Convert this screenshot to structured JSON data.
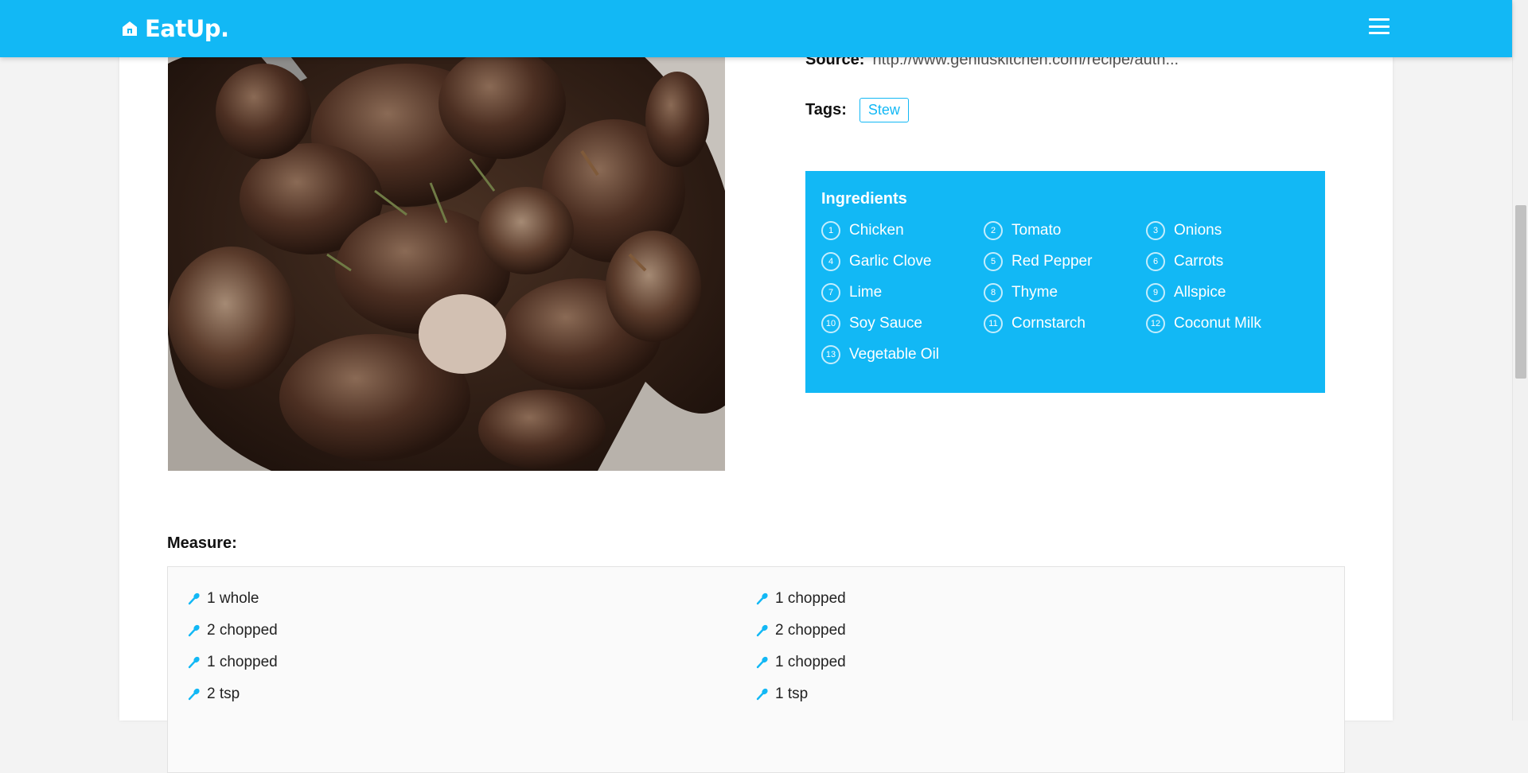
{
  "header": {
    "brand": "EatUp.",
    "brand_icon": "home-icon",
    "menu_icon": "hamburger-icon"
  },
  "colors": {
    "accent": "#12b8f5"
  },
  "recipe": {
    "source_label": "Source:",
    "source_url": "http://www.geniuskitchen.com/recipe/auth...",
    "tags_label": "Tags:",
    "tags": [
      "Stew"
    ]
  },
  "ingredients": {
    "title": "Ingredients",
    "items": [
      {
        "num": "1",
        "name": "Chicken"
      },
      {
        "num": "2",
        "name": "Tomato"
      },
      {
        "num": "3",
        "name": "Onions"
      },
      {
        "num": "4",
        "name": "Garlic Clove"
      },
      {
        "num": "5",
        "name": "Red Pepper"
      },
      {
        "num": "6",
        "name": "Carrots"
      },
      {
        "num": "7",
        "name": "Lime"
      },
      {
        "num": "8",
        "name": "Thyme"
      },
      {
        "num": "9",
        "name": "Allspice"
      },
      {
        "num": "10",
        "name": "Soy Sauce"
      },
      {
        "num": "11",
        "name": "Cornstarch"
      },
      {
        "num": "12",
        "name": "Coconut Milk"
      },
      {
        "num": "13",
        "name": "Vegetable Oil"
      }
    ]
  },
  "measure": {
    "title": "Measure:",
    "items": [
      "1 whole",
      "1 chopped",
      "2 chopped",
      "2 chopped",
      "1 chopped",
      "1 chopped",
      "2 tsp",
      "1 tsp"
    ]
  }
}
